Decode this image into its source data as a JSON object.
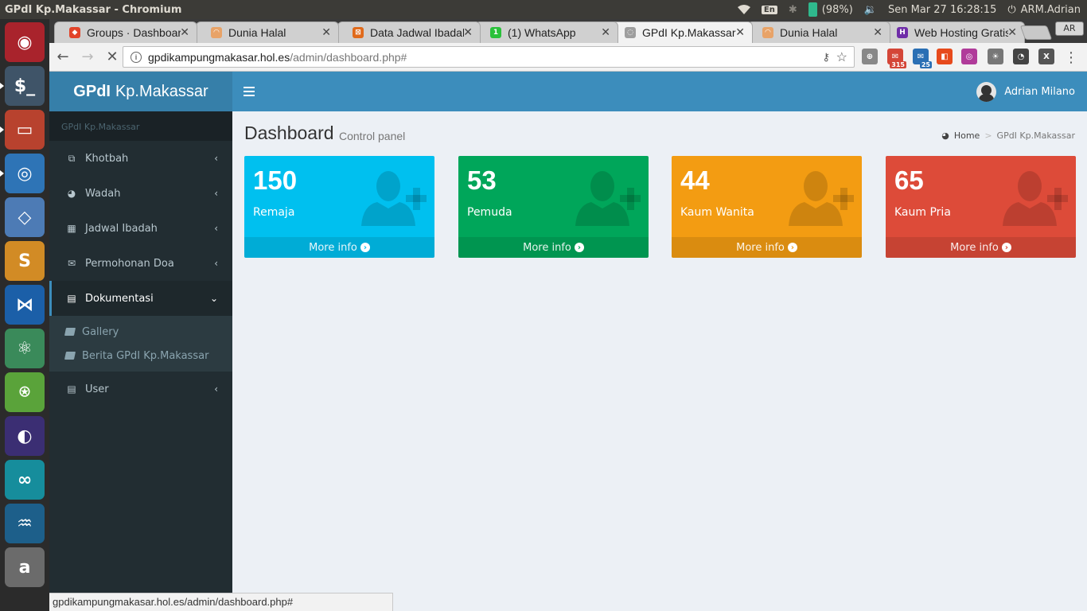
{
  "os_panel": {
    "window_title": "GPdI Kp.Makassar - Chromium",
    "keyboard_layout": "En",
    "battery": "(98%)",
    "datetime": "Sen Mar 27 16:28:15",
    "user": "ARM.Adrian"
  },
  "launcher": {
    "apps": [
      {
        "name": "ubuntu-dash",
        "color": "#a9232c",
        "glyph": "◉"
      },
      {
        "name": "terminal",
        "color": "#3f5468",
        "glyph": "$_"
      },
      {
        "name": "files",
        "color": "#b8422e",
        "glyph": "▭"
      },
      {
        "name": "chromium",
        "color": "#2e74b6",
        "glyph": "◎"
      },
      {
        "name": "virtualbox",
        "color": "#4d7bb5",
        "glyph": "◇"
      },
      {
        "name": "sublime-text",
        "color": "#d28b25",
        "glyph": "S"
      },
      {
        "name": "vscode",
        "color": "#1b5fa8",
        "glyph": "⋈"
      },
      {
        "name": "atom",
        "color": "#3a8a5a",
        "glyph": "⚛"
      },
      {
        "name": "android-studio",
        "color": "#5aa33a",
        "glyph": "⍟"
      },
      {
        "name": "eclipse",
        "color": "#3b2e73",
        "glyph": "◐"
      },
      {
        "name": "arduino",
        "color": "#168d9c",
        "glyph": "∞"
      },
      {
        "name": "mysql-workbench",
        "color": "#1d5f8a",
        "glyph": "♒"
      },
      {
        "name": "amazon",
        "color": "#6b6b6b",
        "glyph": "a"
      }
    ]
  },
  "browser": {
    "tabs": [
      {
        "title": "Groups · Dashboard",
        "fav_color": "#e24329",
        "fav_glyph": "◆"
      },
      {
        "title": "Dunia Halal",
        "fav_color": "#e8a368",
        "fav_glyph": "◠"
      },
      {
        "title": "Data Jadwal Ibadah",
        "fav_color": "#e06a1b",
        "fav_glyph": "⊠"
      },
      {
        "title": "(1) WhatsApp",
        "fav_color": "#2ac13a",
        "fav_glyph": "1"
      },
      {
        "title": "GPdI Kp.Makassar",
        "fav_color": "#9e9e9e",
        "fav_glyph": "◌"
      },
      {
        "title": "Dunia Halal",
        "fav_color": "#e8a368",
        "fav_glyph": "◠"
      },
      {
        "title": "Web Hosting Gratis",
        "fav_color": "#6f2da8",
        "fav_glyph": "H"
      }
    ],
    "profile_label": "AR",
    "url_host": "gpdikampungmakasar.hol.es",
    "url_path": "/admin/dashboard.php#",
    "extensions": [
      {
        "name": "target-icon",
        "color": "#888888",
        "glyph": "⊕",
        "badge": ""
      },
      {
        "name": "gmail-icon",
        "color": "#d44638",
        "glyph": "✉",
        "badge": "315"
      },
      {
        "name": "mail-icon",
        "color": "#2a6fb4",
        "glyph": "✉",
        "badge": "25"
      },
      {
        "name": "office-icon",
        "color": "#e74a1c",
        "glyph": "◧",
        "badge": ""
      },
      {
        "name": "instagram-icon",
        "color": "#b03b9a",
        "glyph": "◎",
        "badge": ""
      },
      {
        "name": "bulb-icon",
        "color": "#777777",
        "glyph": "☀",
        "badge": ""
      },
      {
        "name": "speed-icon",
        "color": "#444444",
        "glyph": "◔",
        "badge": ""
      },
      {
        "name": "x-icon",
        "color": "#555555",
        "glyph": "X",
        "badge": ""
      }
    ],
    "status_url": "gpdikampungmakasar.hol.es/admin/dashboard.php#"
  },
  "app": {
    "logo_bold": "GPdI",
    "logo_rest": "Kp.Makassar",
    "user_name": "Adrian Milano",
    "sidebar_header": "GPdI Kp.Makassar",
    "menu": [
      {
        "label": "Khotbah",
        "icon": "copy-icon",
        "glyph": "⧉"
      },
      {
        "label": "Wadah",
        "icon": "pie-chart-icon",
        "glyph": "◕"
      },
      {
        "label": "Jadwal Ibadah",
        "icon": "calendar-icon",
        "glyph": "▦"
      },
      {
        "label": "Permohonan Doa",
        "icon": "envelope-icon",
        "glyph": "✉"
      },
      {
        "label": "Dokumentasi",
        "icon": "book-icon",
        "glyph": "▤"
      }
    ],
    "submenu": [
      "Gallery",
      "Berita GPdI Kp.Makassar"
    ],
    "menu_last": {
      "label": "User",
      "icon": "book-icon",
      "glyph": "▤"
    },
    "page_title": "Dashboard",
    "page_subtitle": "Control panel",
    "breadcrumb_home": "Home",
    "breadcrumb_current": "GPdI Kp.Makassar",
    "stats": [
      {
        "value": "150",
        "label": "Remaja",
        "color": "#00c0ef",
        "footer": "More info"
      },
      {
        "value": "53",
        "label": "Pemuda",
        "color": "#00a65a",
        "footer": "More info"
      },
      {
        "value": "44",
        "label": "Kaum Wanita",
        "color": "#f39c12",
        "footer": "More info"
      },
      {
        "value": "65",
        "label": "Kaum Pria",
        "color": "#dd4b39",
        "footer": "More info"
      }
    ]
  }
}
